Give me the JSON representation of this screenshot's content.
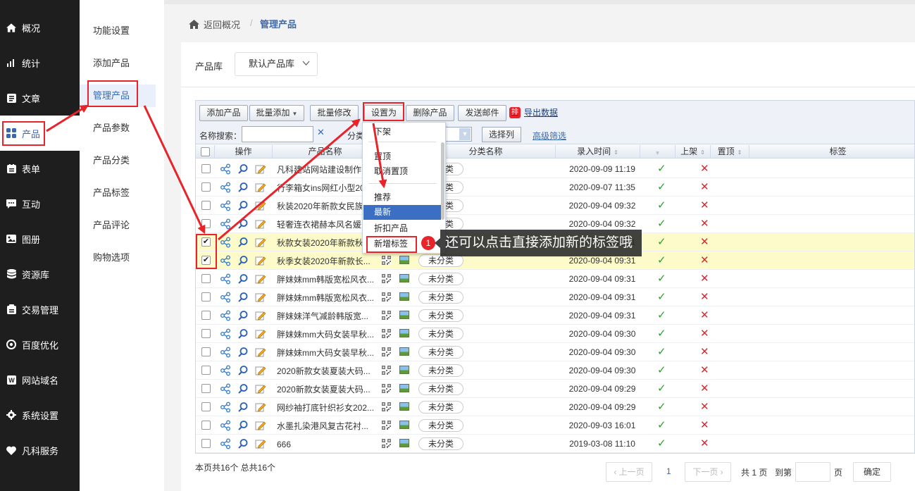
{
  "nav": [
    {
      "label": "概况",
      "icon": "home-icon"
    },
    {
      "label": "统计",
      "icon": "chart-icon"
    },
    {
      "label": "文章",
      "icon": "article-icon"
    },
    {
      "label": "产品",
      "icon": "grid-icon",
      "active": true
    },
    {
      "label": "表单",
      "icon": "form-icon"
    },
    {
      "label": "互动",
      "icon": "chat-icon"
    },
    {
      "label": "图册",
      "icon": "album-icon"
    },
    {
      "label": "资源库",
      "icon": "database-icon"
    },
    {
      "label": "交易管理",
      "icon": "trade-icon"
    },
    {
      "label": "百度优化",
      "icon": "seo-icon"
    },
    {
      "label": "网站域名",
      "icon": "domain-icon"
    },
    {
      "label": "系统设置",
      "icon": "gear-icon"
    },
    {
      "label": "凡科服务",
      "icon": "heart-icon"
    }
  ],
  "subnav": [
    "功能设置",
    "添加产品",
    "管理产品",
    "产品参数",
    "产品分类",
    "产品标签",
    "产品评论",
    "购物选项"
  ],
  "breadcrumb": {
    "back": "返回概况",
    "sep": "/",
    "current": "管理产品"
  },
  "library": {
    "label": "产品库",
    "value": "默认产品库"
  },
  "toolbar": {
    "add": "添加产品",
    "batch_add": "批量添加",
    "batch_edit": "批量修改",
    "set_as": "设置为",
    "delete": "删除产品",
    "email": "发送邮件",
    "export_badge": "排",
    "export": "导出数据",
    "search_label": "名称搜索：",
    "category_label": "分类",
    "choose_columns": "选择列",
    "advanced": "高级筛选"
  },
  "columns": {
    "ops": "操作",
    "name": "产品名称",
    "category": "分类名称",
    "time": "录入时间",
    "online": "上架",
    "top": "置顶",
    "tag": "标签"
  },
  "rows": [
    {
      "name": "凡科建站网站建设制作",
      "category": "未分类",
      "time": "2020-09-09 11:19",
      "checked": false
    },
    {
      "name": "行李箱女ins网红小型20",
      "category": "未分类",
      "time": "2020-09-07 11:35",
      "checked": false
    },
    {
      "name": "秋装2020年新款女民族",
      "category": "未分类",
      "time": "2020-09-04 09:32",
      "checked": false
    },
    {
      "name": "轻奢连衣裙赫本风名媛",
      "category": "未分类",
      "time": "2020-09-04 09:32",
      "checked": false
    },
    {
      "name": "秋款女装2020年新款秋",
      "category": "未分类",
      "time": "2020-09-04 09:31",
      "checked": true
    },
    {
      "name": "秋季女装2020年新款长...",
      "category": "未分类",
      "time": "2020-09-04 09:31",
      "checked": true
    },
    {
      "name": "胖妹妹mm韩版宽松风衣...",
      "category": "未分类",
      "time": "2020-09-04 09:31",
      "checked": false
    },
    {
      "name": "胖妹妹mm韩版宽松风衣...",
      "category": "未分类",
      "time": "2020-09-04 09:31",
      "checked": false
    },
    {
      "name": "胖妹妹洋气减龄韩版宽...",
      "category": "未分类",
      "time": "2020-09-04 09:31",
      "checked": false
    },
    {
      "name": "胖妹妹mm大码女装早秋...",
      "category": "未分类",
      "time": "2020-09-04 09:30",
      "checked": false
    },
    {
      "name": "胖妹妹mm大码女装早秋...",
      "category": "未分类",
      "time": "2020-09-04 09:30",
      "checked": false
    },
    {
      "name": "2020新款女装夏装大码...",
      "category": "未分类",
      "time": "2020-09-04 09:30",
      "checked": false
    },
    {
      "name": "2020新款女装夏装大码...",
      "category": "未分类",
      "time": "2020-09-04 09:29",
      "checked": false
    },
    {
      "name": "网纱袖打底针织衫女202...",
      "category": "未分类",
      "time": "2020-09-04 09:29",
      "checked": false
    },
    {
      "name": "水墨扎染港风复古花衬...",
      "category": "未分类",
      "time": "2020-09-03 16:01",
      "checked": false
    },
    {
      "name": "666",
      "category": "未分类",
      "time": "2019-03-08 11:10",
      "checked": false
    }
  ],
  "marks": {
    "ok": "✓",
    "no": "✕"
  },
  "menu": {
    "items": [
      "下架",
      "置顶",
      "取消置顶",
      "推荐",
      "最新",
      "折扣产品",
      "新增标签"
    ],
    "hot_index": 4
  },
  "tooltip": {
    "step": "1",
    "text": "还可以点击直接添加新的标签哦"
  },
  "footer": {
    "count": "本页共16个 总共16个",
    "prev": "上一页",
    "page": "1",
    "next": "下一页",
    "total": "共 1 页",
    "goto": "到第",
    "unit": "页",
    "confirm": "确定"
  }
}
